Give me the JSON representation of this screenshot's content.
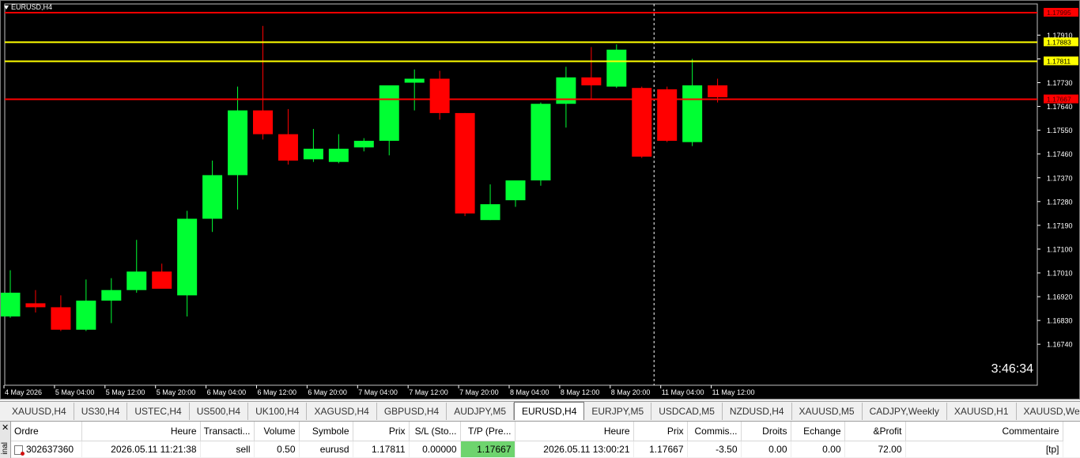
{
  "chart": {
    "title": "EURUSD,H4",
    "countdown": "3:46:34",
    "colors": {
      "bull": "#00ff33",
      "bear": "#ff0000",
      "bg": "#000000",
      "axis": "#ffffff",
      "hline_red": "#ff0000",
      "hline_yellow": "#ffff00"
    }
  },
  "chart_data": {
    "type": "candlestick",
    "symbol": "EURUSD",
    "timeframe": "H4",
    "ylim": [
      1.1674,
      1.1804
    ],
    "y_ticks": [
      "1.17910",
      "1.17820",
      "1.17730",
      "1.17640",
      "1.17550",
      "1.17460",
      "1.17370",
      "1.17280",
      "1.17190",
      "1.17100",
      "1.17010",
      "1.16920",
      "1.16830",
      "1.16740"
    ],
    "x_labels": [
      "4 May 2026",
      "5 May 04:00",
      "5 May 12:00",
      "5 May 20:00",
      "6 May 04:00",
      "6 May 12:00",
      "6 May 20:00",
      "7 May 04:00",
      "7 May 12:00",
      "7 May 20:00",
      "8 May 04:00",
      "8 May 12:00",
      "8 May 20:00",
      "11 May 04:00",
      "11 May 12:00"
    ],
    "price_labels": [
      {
        "value": 1.17995,
        "text": "1.17995",
        "color": "#ff0000"
      },
      {
        "value": 1.17883,
        "text": "1.17883",
        "color": "#ffff00"
      },
      {
        "value": 1.17811,
        "text": "1.17811",
        "color": "#ffff00"
      },
      {
        "value": 1.17667,
        "text": "1.17667",
        "color": "#ff0000"
      }
    ],
    "candles": [
      {
        "o": 1.16845,
        "h": 1.1702,
        "l": 1.1684,
        "c": 1.16935
      },
      {
        "o": 1.16895,
        "h": 1.16945,
        "l": 1.1686,
        "c": 1.1688
      },
      {
        "o": 1.1688,
        "h": 1.16925,
        "l": 1.1679,
        "c": 1.16795
      },
      {
        "o": 1.16795,
        "h": 1.16985,
        "l": 1.1679,
        "c": 1.16905
      },
      {
        "o": 1.16905,
        "h": 1.1699,
        "l": 1.1682,
        "c": 1.16945
      },
      {
        "o": 1.16945,
        "h": 1.17135,
        "l": 1.16935,
        "c": 1.17015
      },
      {
        "o": 1.17015,
        "h": 1.17045,
        "l": 1.1695,
        "c": 1.1695
      },
      {
        "o": 1.16925,
        "h": 1.17245,
        "l": 1.16845,
        "c": 1.17215
      },
      {
        "o": 1.17215,
        "h": 1.17435,
        "l": 1.17165,
        "c": 1.1738
      },
      {
        "o": 1.1738,
        "h": 1.17715,
        "l": 1.1725,
        "c": 1.17625
      },
      {
        "o": 1.17625,
        "h": 1.17945,
        "l": 1.17515,
        "c": 1.17535
      },
      {
        "o": 1.17535,
        "h": 1.1763,
        "l": 1.1742,
        "c": 1.17435
      },
      {
        "o": 1.1744,
        "h": 1.17555,
        "l": 1.1743,
        "c": 1.1748
      },
      {
        "o": 1.1743,
        "h": 1.17535,
        "l": 1.17425,
        "c": 1.1748
      },
      {
        "o": 1.17485,
        "h": 1.1752,
        "l": 1.1747,
        "c": 1.1751
      },
      {
        "o": 1.1751,
        "h": 1.1764,
        "l": 1.17455,
        "c": 1.1772
      },
      {
        "o": 1.1773,
        "h": 1.1778,
        "l": 1.17625,
        "c": 1.17745
      },
      {
        "o": 1.17745,
        "h": 1.17775,
        "l": 1.1759,
        "c": 1.17615
      },
      {
        "o": 1.17615,
        "h": 1.17615,
        "l": 1.17225,
        "c": 1.17235
      },
      {
        "o": 1.1721,
        "h": 1.17345,
        "l": 1.1721,
        "c": 1.1727
      },
      {
        "o": 1.17285,
        "h": 1.17355,
        "l": 1.1726,
        "c": 1.1736
      },
      {
        "o": 1.1736,
        "h": 1.17655,
        "l": 1.1734,
        "c": 1.1765
      },
      {
        "o": 1.1765,
        "h": 1.1779,
        "l": 1.1756,
        "c": 1.1775
      },
      {
        "o": 1.1775,
        "h": 1.17865,
        "l": 1.1767,
        "c": 1.1772
      },
      {
        "o": 1.17715,
        "h": 1.17875,
        "l": 1.1771,
        "c": 1.17855
      },
      {
        "o": 1.1771,
        "h": 1.17715,
        "l": 1.17445,
        "c": 1.1745
      },
      {
        "o": 1.17705,
        "h": 1.17715,
        "l": 1.17505,
        "c": 1.1751
      },
      {
        "o": 1.17505,
        "h": 1.1782,
        "l": 1.1749,
        "c": 1.1772
      },
      {
        "o": 1.1772,
        "h": 1.17745,
        "l": 1.17655,
        "c": 1.17675
      }
    ]
  },
  "symbol_tabs": [
    "XAUUSD,H4",
    "US30,H4",
    "USTEC,H4",
    "US500,H4",
    "UK100,H4",
    "XAGUSD,H4",
    "GBPUSD,H4",
    "AUDJPY,M5",
    "EURUSD,H4",
    "EURJPY,M5",
    "USDCAD,M5",
    "NZDUSD,H4",
    "XAUUSD,M5",
    "CADJPY,Weekly",
    "XAUUSD,H1",
    "XAUUSD,Wee"
  ],
  "active_tab": "EURUSD,H4",
  "terminal": {
    "side_label": "inal",
    "columns": [
      "Ordre",
      "Heure",
      "Transacti...",
      "Volume",
      "Symbole",
      "Prix",
      "S/L (Sto...",
      "T/P (Pre...",
      "Heure",
      "Prix",
      "Commis...",
      "Droits",
      "Echange",
      "&Profit",
      "Commentaire"
    ],
    "rows": [
      [
        "302637360",
        "2026.05.11 11:21:38",
        "sell",
        "0.50",
        "eurusd",
        "1.17811",
        "0.00000",
        "1.17667",
        "2026.05.11 13:00:21",
        "1.17667",
        "-3.50",
        "0.00",
        "0.00",
        "72.00",
        "[tp]"
      ]
    ]
  }
}
